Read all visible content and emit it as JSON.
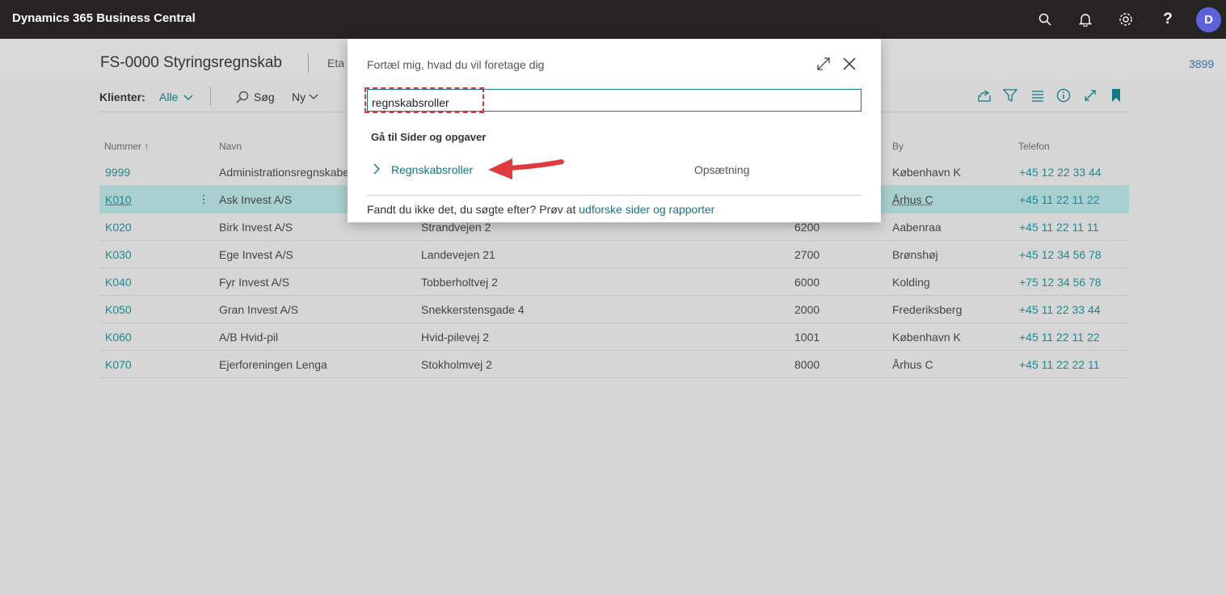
{
  "app": {
    "title": "Dynamics 365 Business Central",
    "avatar_initial": "D"
  },
  "topbar_icons": [
    "search-icon",
    "bell-icon",
    "gear-icon",
    "help-icon"
  ],
  "page": {
    "title": "FS-0000 Styringsregnskab",
    "title_fragment": "Eta",
    "right_number": "3899"
  },
  "toolbar": {
    "label": "Klienter:",
    "filter": "Alle",
    "search_label": "Søg",
    "new_label": "Ny"
  },
  "table": {
    "headers": {
      "nummer": "Nummer ↑",
      "navn": "Navn",
      "by": "By",
      "telefon": "Telefon"
    },
    "rows": [
      {
        "nummer": "9999",
        "navn": "Administrationsregnskabet",
        "adresse": "",
        "postnr": "",
        "by": "København K",
        "telefon": "+45 12 22 33 44"
      },
      {
        "nummer": "K010",
        "navn": "Ask Invest A/S",
        "adresse": "",
        "postnr": "",
        "by": "Århus C",
        "telefon": "+45 11 22 11 22"
      },
      {
        "nummer": "K020",
        "navn": "Birk Invest A/S",
        "adresse": "Strandvejen 2",
        "postnr": "6200",
        "by": "Aabenraa",
        "telefon": "+45 11 22 11 11"
      },
      {
        "nummer": "K030",
        "navn": "Ege Invest A/S",
        "adresse": "Landevejen 21",
        "postnr": "2700",
        "by": "Brønshøj",
        "telefon": "+45 12 34 56 78"
      },
      {
        "nummer": "K040",
        "navn": "Fyr Invest A/S",
        "adresse": "Tobberholtvej 2",
        "postnr": "6000",
        "by": "Kolding",
        "telefon": "+75 12 34 56 78"
      },
      {
        "nummer": "K050",
        "navn": "Gran Invest A/S",
        "adresse": "Snekkerstensgade 4",
        "postnr": "2000",
        "by": "Frederiksberg",
        "telefon": "+45 11 22 33 44"
      },
      {
        "nummer": "K060",
        "navn": "A/B Hvid-pil",
        "adresse": "Hvid-pilevej 2",
        "postnr": "1001",
        "by": "København K",
        "telefon": "+45 11 22 11 22"
      },
      {
        "nummer": "K070",
        "navn": "Ejerforeningen Lenga",
        "adresse": "Stokholmvej 2",
        "postnr": "8000",
        "by": "Århus C",
        "telefon": "+45 11 22 22 11"
      }
    ]
  },
  "dialog": {
    "title": "Fortæl mig, hvad du vil foretage dig",
    "search_value": "regnskabsroller",
    "section_heading": "Gå til Sider og opgaver",
    "result_label": "Regnskabsroller",
    "result_category": "Opsætning",
    "footer_text": "Fandt du ikke det, du søgte efter? Prøv at ",
    "footer_link": "udforske sider og rapporter"
  },
  "colors": {
    "accent": "#0f7a83",
    "topbar": "#252423",
    "avatar": "#5b62dc",
    "highlight": "#e0393e"
  }
}
